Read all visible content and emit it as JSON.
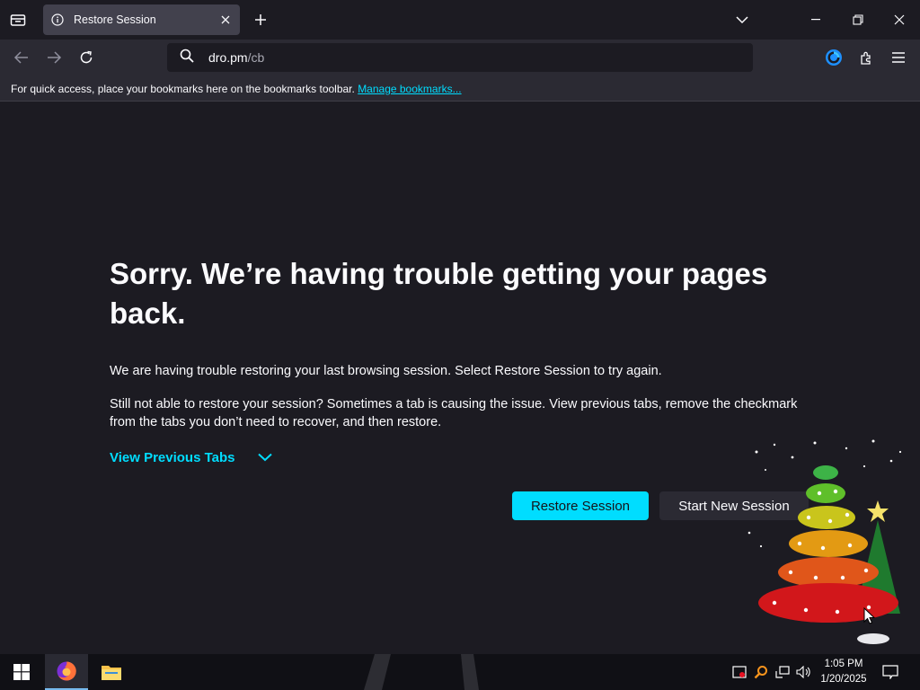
{
  "window": {
    "tab_title": "Restore Session"
  },
  "navbar": {
    "url_host": "dro.pm",
    "url_path": "/cb"
  },
  "bookmarks_bar": {
    "message": "For quick access, place your bookmarks here on the bookmarks toolbar. ",
    "manage_link": "Manage bookmarks..."
  },
  "page": {
    "headline": "Sorry. We’re having trouble getting your pages back.",
    "paragraph1": "We are having trouble restoring your last browsing session. Select Restore Session to try again.",
    "paragraph2": "Still not able to restore your session? Sometimes a tab is causing the issue. View previous tabs, remove the checkmark from the tabs you don’t need to recover, and then restore.",
    "view_previous_tabs": "View Previous Tabs",
    "restore_button": "Restore Session",
    "new_session_button": "Start New Session"
  },
  "taskbar": {
    "time": "1:05 PM",
    "date": "1/20/2025"
  },
  "colors": {
    "accent": "#00ddff",
    "background": "#1c1b22",
    "toolbar": "#2b2a33"
  }
}
